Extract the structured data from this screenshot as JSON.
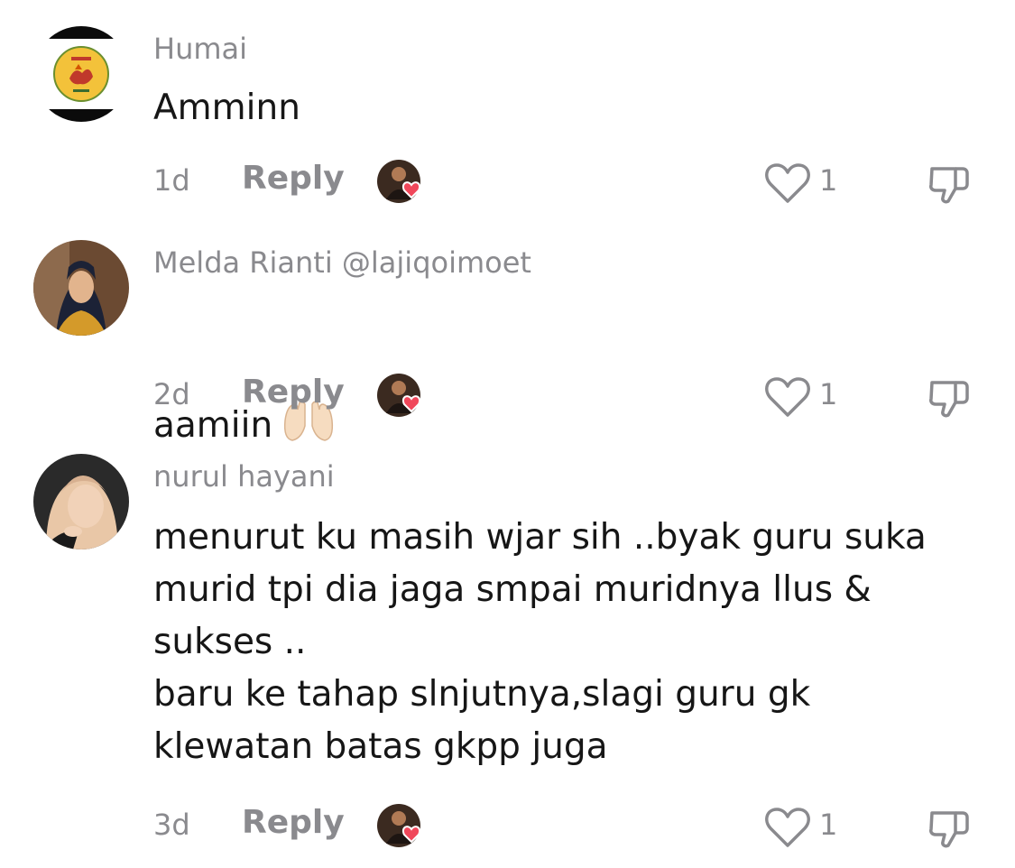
{
  "comments": [
    {
      "username": "Humai",
      "text": "Amminn",
      "time": "1d",
      "reply_label": "Reply",
      "likes": "1"
    },
    {
      "username": "Melda Rianti @lajiqoimoet",
      "text": "aamiin",
      "emoji": "raised-hands-emoji",
      "time": "2d",
      "reply_label": "Reply",
      "likes": "1"
    },
    {
      "username": "nurul hayani",
      "text": "menurut ku masih wjar sih ..byak guru suka\nmurid tpi dia jaga smpai muridnya llus &\nsukses ..\nbaru ke tahap slnjutnya,slagi guru gk\nklewatan batas gkpp juga",
      "time": "3d",
      "reply_label": "Reply",
      "likes": "1"
    }
  ],
  "colors": {
    "muted": "#8a8a8e",
    "text": "#161616",
    "heart_badge": "#f0475a"
  }
}
